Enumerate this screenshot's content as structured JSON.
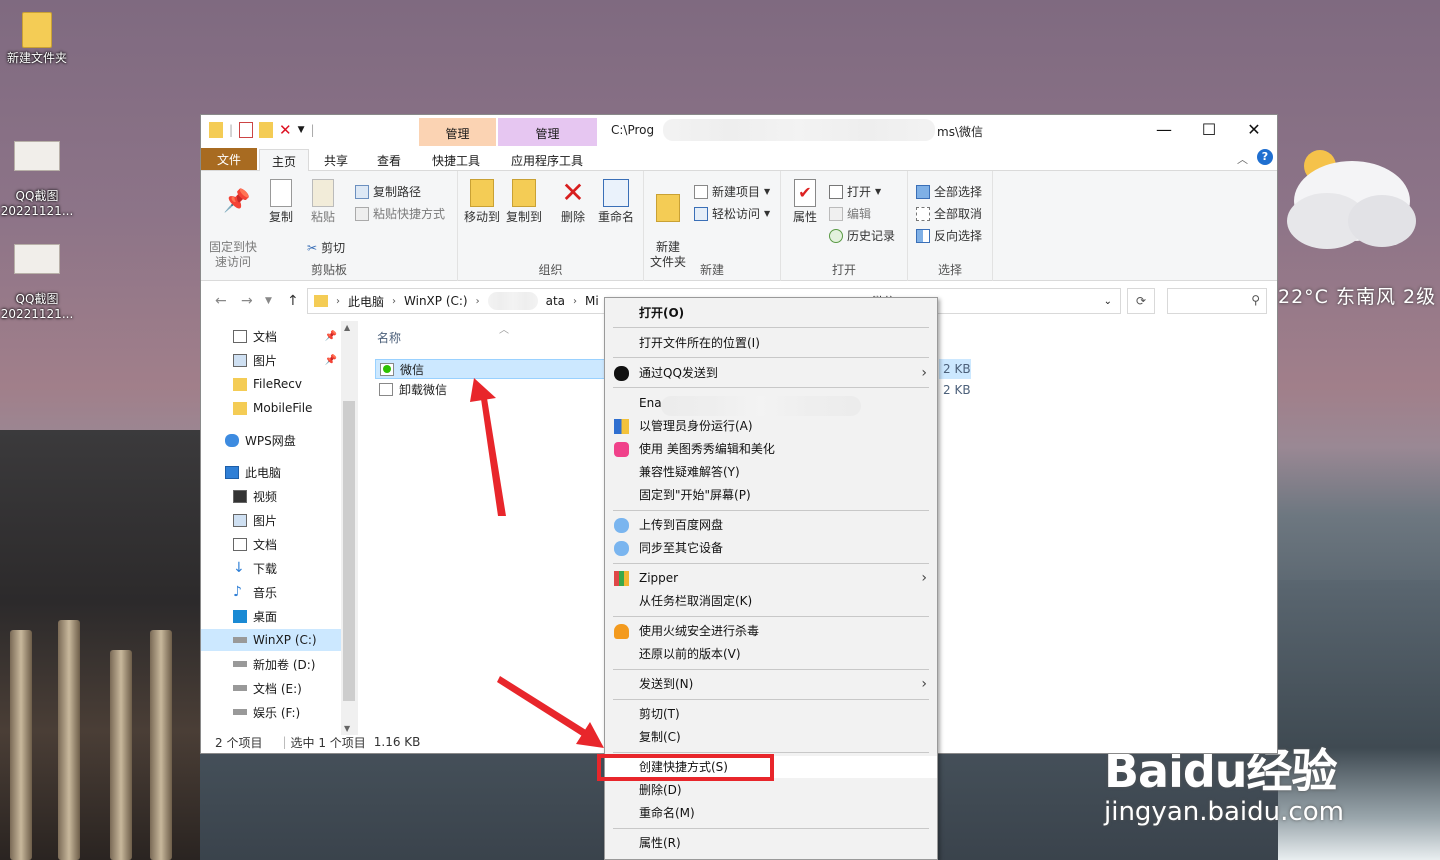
{
  "desktop": {
    "icons": [
      {
        "label": "新建文件夹"
      },
      {
        "label": "QQ截图\n20221121..."
      },
      {
        "label": "QQ截图\n20221121..."
      }
    ],
    "weather": "22°C  东南风  2级",
    "watermark_big": "Baidu经验",
    "watermark_small": "jingyan.baidu.com"
  },
  "window": {
    "title": "C:\\Prog",
    "title_tail": "ms\\微信",
    "ctx_tab1": "管理",
    "ctx_tab2": "管理",
    "tabs": [
      "文件",
      "主页",
      "共享",
      "查看",
      "快捷工具",
      "应用程序工具"
    ],
    "controls": {
      "min": "—",
      "max": "☐",
      "close": "✕"
    },
    "ribbon": {
      "clipboard": {
        "label": "剪贴板",
        "pin": "固定到快\n速访问",
        "copy": "复制",
        "paste": "粘贴",
        "copy_path": "复制路径",
        "paste_shortcut": "粘贴快捷方式",
        "cut": "剪切"
      },
      "organize": {
        "label": "组织",
        "move_to": "移动到",
        "copy_to": "复制到",
        "delete": "删除",
        "rename": "重命名"
      },
      "new": {
        "label": "新建",
        "new_folder": "新建\n文件夹",
        "new_item": "新建项目",
        "easy_access": "轻松访问"
      },
      "open": {
        "label": "打开",
        "properties": "属性",
        "open": "打开",
        "edit": "编辑",
        "history": "历史记录"
      },
      "select": {
        "label": "选择",
        "select_all": "全部选择",
        "select_none": "全部取消",
        "invert": "反向选择"
      }
    },
    "address": {
      "parts": [
        "此电脑",
        "WinXP (C:)",
        "ata",
        "Mi",
        "微信"
      ],
      "search_icon": "search-icon"
    },
    "nav": [
      {
        "label": "文档",
        "pinned": true
      },
      {
        "label": "图片",
        "pinned": true
      },
      {
        "label": "FileRecv",
        "pinned": false
      },
      {
        "label": "MobileFile",
        "pinned": false
      },
      {
        "label": "WPS网盘",
        "pinned": false
      },
      {
        "label": "此电脑",
        "pinned": false
      },
      {
        "label": "视频",
        "pinned": false
      },
      {
        "label": "图片",
        "pinned": false
      },
      {
        "label": "文档",
        "pinned": false
      },
      {
        "label": "下载",
        "pinned": false
      },
      {
        "label": "音乐",
        "pinned": false
      },
      {
        "label": "桌面",
        "pinned": false
      },
      {
        "label": "WinXP (C:)",
        "pinned": false
      },
      {
        "label": "新加卷 (D:)",
        "pinned": false
      },
      {
        "label": "文档 (E:)",
        "pinned": false
      },
      {
        "label": "娱乐 (F:)",
        "pinned": false
      }
    ],
    "column_name": "名称",
    "files": [
      {
        "name": "微信",
        "size": "2 KB",
        "selected": true
      },
      {
        "name": "卸载微信",
        "size": "2 KB",
        "selected": false
      }
    ],
    "status": {
      "count": "2 个项目",
      "selected": "选中 1 个项目",
      "size": "1.16 KB"
    }
  },
  "context_menu": [
    {
      "label": "打开(O)",
      "bold": true
    },
    {
      "label": "打开文件所在的位置(I)"
    },
    {
      "label": "通过QQ发送到",
      "submenu": true
    },
    {
      "label": "Ena"
    },
    {
      "label": "以管理员身份运行(A)"
    },
    {
      "label": "使用 美图秀秀编辑和美化"
    },
    {
      "label": "兼容性疑难解答(Y)"
    },
    {
      "label": "固定到\"开始\"屏幕(P)"
    },
    {
      "label": "上传到百度网盘"
    },
    {
      "label": "同步至其它设备"
    },
    {
      "label": "Zipper",
      "submenu": true
    },
    {
      "label": "从任务栏取消固定(K)"
    },
    {
      "label": "使用火绒安全进行杀毒"
    },
    {
      "label": "还原以前的版本(V)"
    },
    {
      "label": "发送到(N)",
      "submenu": true
    },
    {
      "label": "剪切(T)"
    },
    {
      "label": "复制(C)"
    },
    {
      "label": "创建快捷方式(S)",
      "highlighted": true
    },
    {
      "label": "删除(D)"
    },
    {
      "label": "重命名(M)"
    },
    {
      "label": "属性(R)"
    }
  ],
  "colors": {
    "file_tab": "#a86b21",
    "ctx_tab1": "#fbd3b3",
    "ctx_tab2": "#e6c6f1",
    "selection": "#cce8ff",
    "annotation": "#e8262b"
  }
}
